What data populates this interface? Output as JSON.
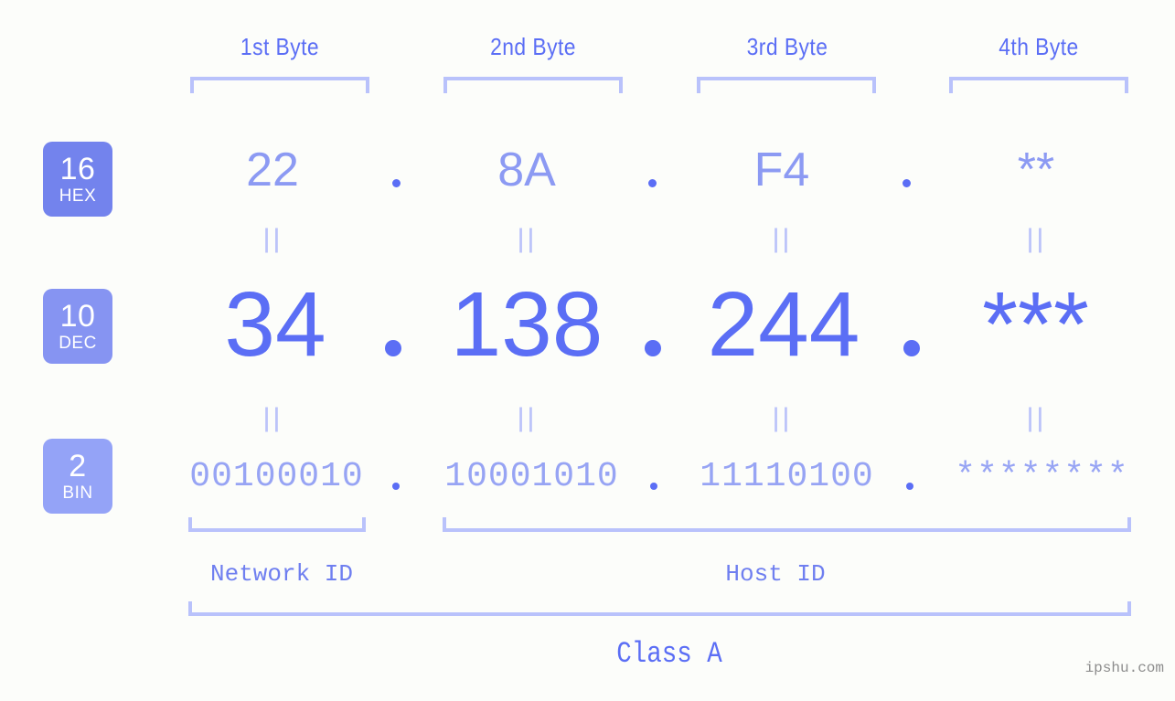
{
  "page": {
    "background_color": "#fcfdfa",
    "accent_color": "#5b6ef5",
    "bracket_color": "#b9c2fb",
    "watermark": "ipshu.com"
  },
  "byte_headers": [
    {
      "label": "1st Byte"
    },
    {
      "label": "2nd Byte"
    },
    {
      "label": "3rd Byte"
    },
    {
      "label": "4th Byte"
    }
  ],
  "bases": [
    {
      "num": "16",
      "label": "HEX",
      "color": "#7383ed"
    },
    {
      "num": "10",
      "label": "DEC",
      "color": "#8694f2"
    },
    {
      "num": "2",
      "label": "BIN",
      "color": "#94a3f7"
    }
  ],
  "rows": {
    "hex": {
      "values": [
        "22",
        "8A",
        "F4",
        "**"
      ]
    },
    "dec": {
      "values": [
        "34",
        "138",
        "244",
        "***"
      ]
    },
    "bin": {
      "values": [
        "00100010",
        "10001010",
        "11110100",
        "********"
      ]
    }
  },
  "equals_marks": {
    "glyph": "||"
  },
  "segments": {
    "network_id": "Network ID",
    "host_id": "Host ID"
  },
  "address_class": "Class A"
}
